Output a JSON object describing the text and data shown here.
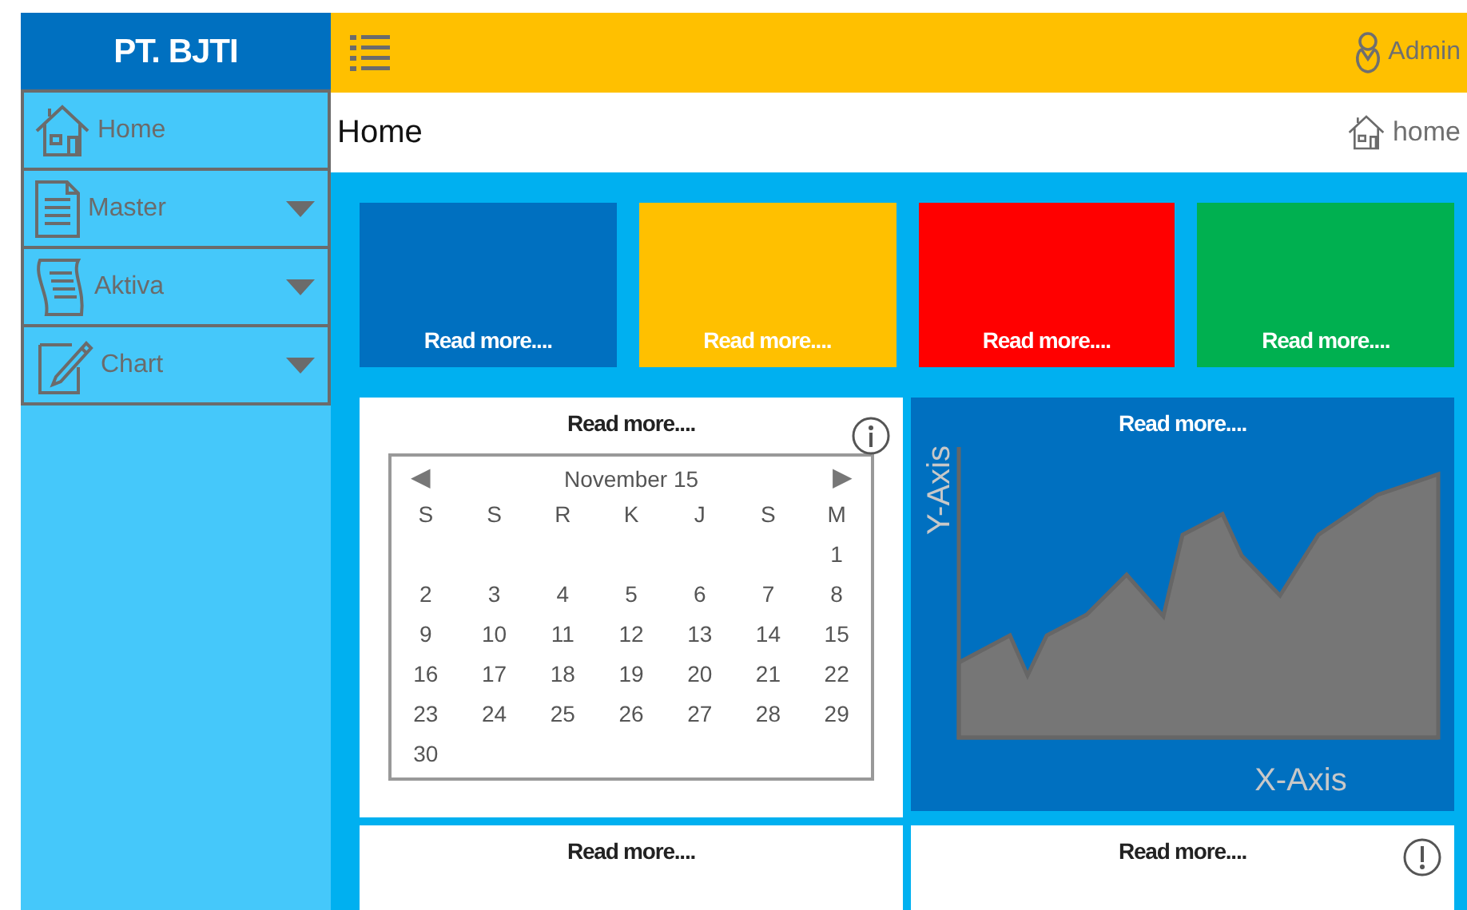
{
  "brand": "PT. BJTI",
  "header": {
    "user": "Admin"
  },
  "sidebar": {
    "items": [
      {
        "label": "Home",
        "expandable": false
      },
      {
        "label": "Master",
        "expandable": true
      },
      {
        "label": "Aktiva",
        "expandable": true
      },
      {
        "label": "Chart",
        "expandable": true
      }
    ]
  },
  "breadcrumb": {
    "title": "Home",
    "crumb": "home"
  },
  "tiles": [
    {
      "link": "Read more....",
      "color": "#0070c0"
    },
    {
      "link": "Read more....",
      "color": "#ffc000"
    },
    {
      "link": "Read more....",
      "color": "#ff0000"
    },
    {
      "link": "Read more....",
      "color": "#00b050"
    }
  ],
  "panels": [
    {
      "kind": "calendar",
      "link": "Read more....",
      "calendar": {
        "month": "November 15",
        "prev": "◀",
        "next": "▶",
        "weekdays": [
          "S",
          "S",
          "R",
          "K",
          "J",
          "S",
          "M"
        ],
        "weeks": [
          [
            "1"
          ],
          [
            "2",
            "3",
            "4",
            "5",
            "6",
            "7",
            "8"
          ],
          [
            "9",
            "10",
            "11",
            "12",
            "13",
            "14",
            "15"
          ],
          [
            "16",
            "17",
            "18",
            "19",
            "20",
            "21",
            "22"
          ],
          [
            "23",
            "24",
            "25",
            "26",
            "27",
            "28",
            "29"
          ],
          [
            "30"
          ]
        ]
      }
    },
    {
      "kind": "chart",
      "link": "Read more....",
      "y_label": "Y-Axis",
      "x_label": "X-Axis"
    },
    {
      "kind": "plain",
      "link": "Read more...."
    },
    {
      "kind": "alert",
      "link": "Read more...."
    }
  ]
}
